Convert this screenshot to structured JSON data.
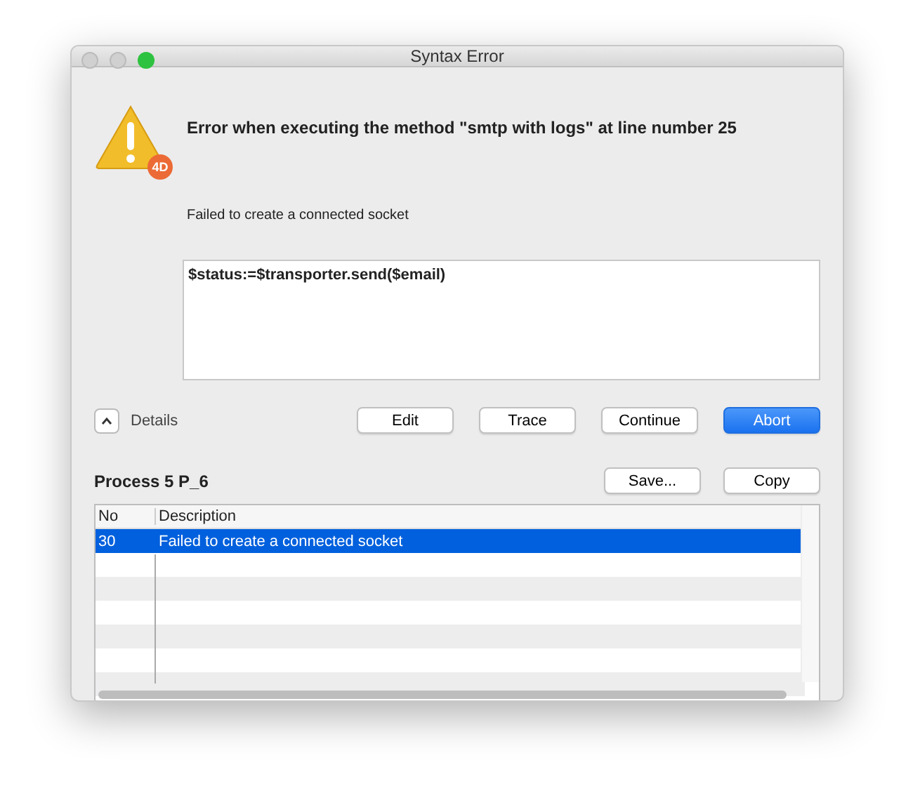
{
  "window": {
    "title": "Syntax Error"
  },
  "icon_badge": "4D",
  "heading": "Error when executing the method \"smtp with logs\" at line number 25",
  "message": "Failed to create a connected socket",
  "code": "$status:=$transporter.send($email)",
  "details": {
    "label": "Details",
    "expanded": true
  },
  "buttons": [
    {
      "label": "Edit",
      "default": false
    },
    {
      "label": "Trace",
      "default": false
    },
    {
      "label": "Continue",
      "default": false
    },
    {
      "label": "Abort",
      "default": true
    }
  ],
  "process": {
    "title": "Process 5 P_6",
    "buttons": [
      "Save...",
      "Copy"
    ]
  },
  "table": {
    "columns": [
      "No",
      "Description"
    ],
    "rows": [
      {
        "no": "30",
        "description": "Failed to create a connected socket",
        "selected": true
      }
    ]
  }
}
